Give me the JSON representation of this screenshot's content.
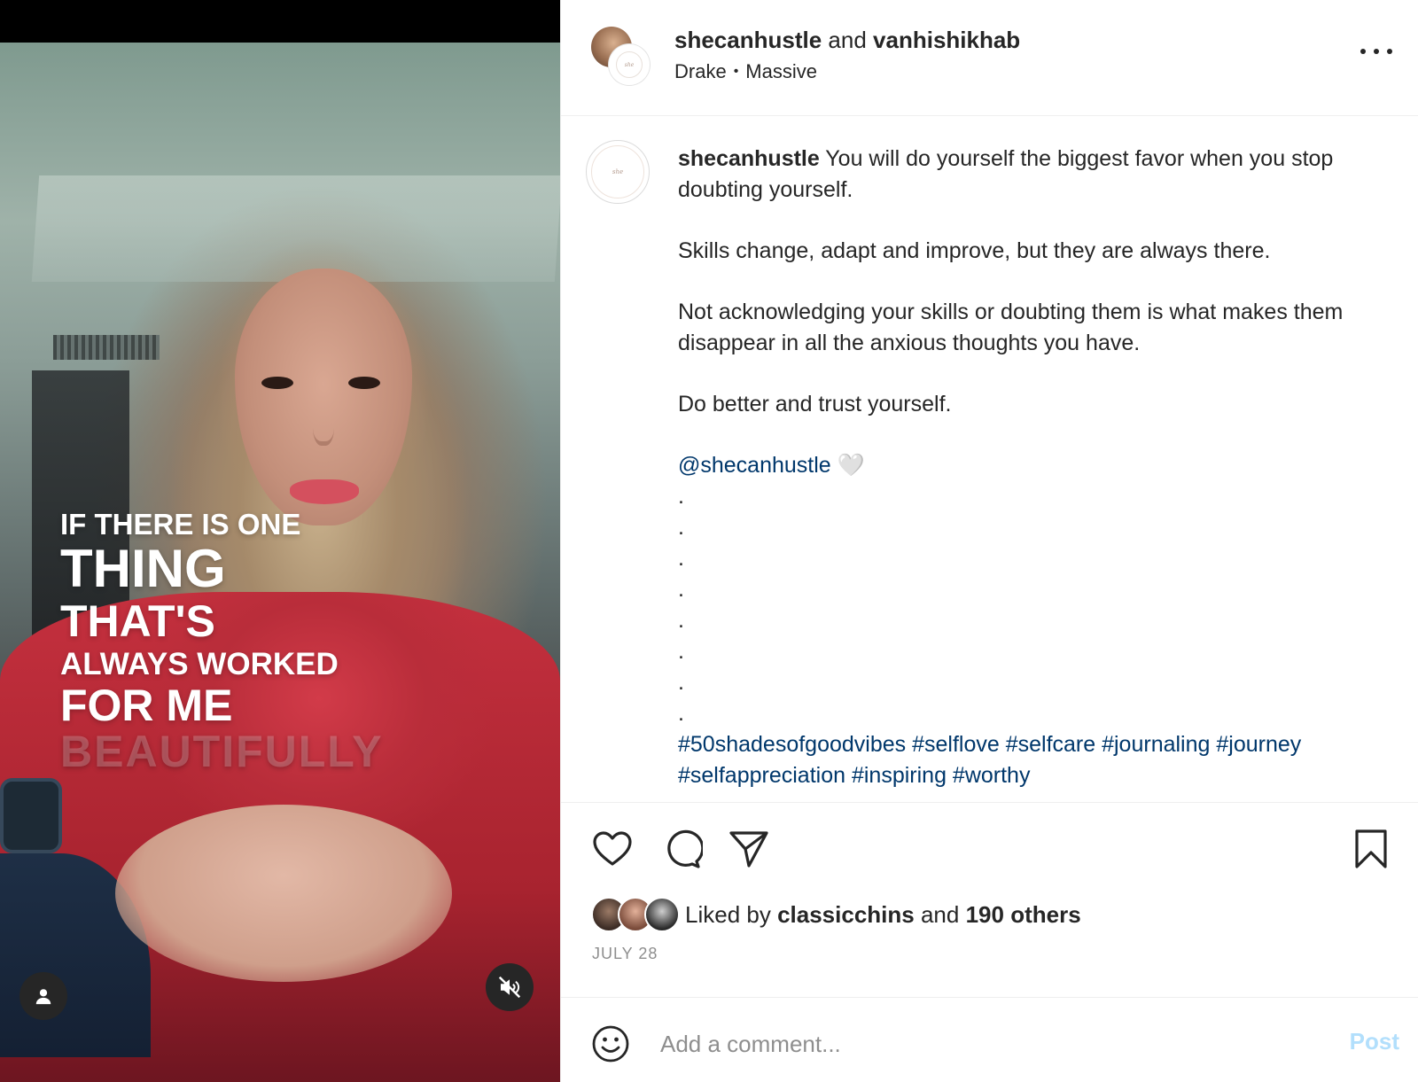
{
  "video": {
    "overlay_lines": [
      "IF THERE IS ONE",
      "THING",
      "THAT'S",
      "ALWAYS WORKED",
      "FOR ME",
      "BEAUTIFULLY"
    ],
    "user_button_icon": "user-icon",
    "mute_button_icon": "speaker-muted-icon"
  },
  "header": {
    "user1": "shecanhustle",
    "joiner": "and",
    "user2": "vanhishikhab",
    "audio_artist": "Drake",
    "audio_separator": "•",
    "audio_track": "Massive",
    "more_icon": "more-options-icon"
  },
  "caption": {
    "username": "shecanhustle",
    "p1": "You will do yourself the biggest favor when you stop doubting yourself.",
    "p2": "Skills change, adapt and improve, but they are always there.",
    "p3": "Not acknowledging your skills or doubting them is what makes them disappear in all the anxious thoughts you have.",
    "p4": "Do better and trust yourself.",
    "mention": "@shecanhustle",
    "heart_emoji": "🤍",
    "dots": [
      ".",
      ".",
      ".",
      ".",
      ".",
      ".",
      ".",
      "."
    ],
    "hashtags": "#50shadesofgoodvibes #selflove #selfcare #journaling #journey #selfappreciation #inspiring #worthy"
  },
  "actions": {
    "like_icon": "heart-icon",
    "comment_icon": "comment-icon",
    "share_icon": "paper-plane-icon",
    "save_icon": "bookmark-icon"
  },
  "likes": {
    "prefix": "Liked by",
    "user": "classicchins",
    "joiner": "and",
    "others": "190 others"
  },
  "date": "JULY 28",
  "comment_box": {
    "placeholder": "Add a comment...",
    "post_label": "Post",
    "emoji_icon": "smiley-icon"
  },
  "colors": {
    "link": "#00376b",
    "post_disabled": "#b2dffc",
    "muted_text": "#8e8e8e"
  }
}
